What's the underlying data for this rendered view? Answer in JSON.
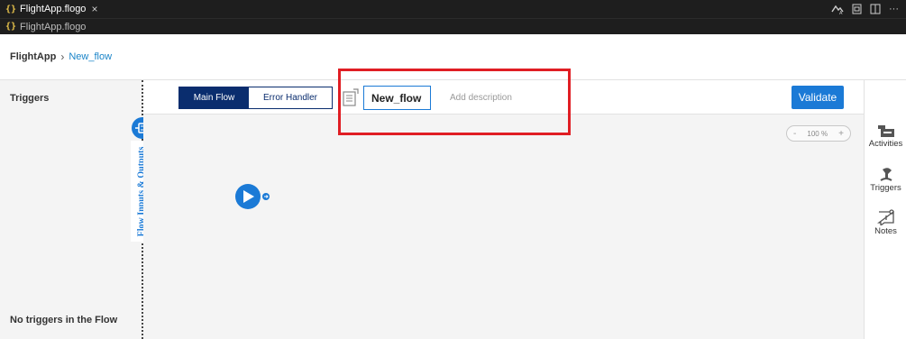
{
  "editor": {
    "tab_label": "FlightApp.flogo",
    "tab_close": "×",
    "path_label": "FlightApp.flogo",
    "json_glyph": "{}",
    "actions": [
      "split-editor-icon",
      "open-preview-icon",
      "layout-icon",
      "more-actions-icon"
    ],
    "more_glyph": "···"
  },
  "breadcrumb": {
    "app": "FlightApp",
    "separator": "›",
    "flow": "New_flow"
  },
  "triggers": {
    "title": "Triggers",
    "empty_text": "No triggers in the Flow",
    "io_label": "Flow Inputs & Outputs"
  },
  "toolbar": {
    "tabs": [
      {
        "label": "Main Flow",
        "active": true
      },
      {
        "label": "Error Handler",
        "active": false
      }
    ],
    "flow_name": "New_flow",
    "description_placeholder": "Add description",
    "validate_label": "Validate"
  },
  "zoom": {
    "minus": "-",
    "level": "100 %",
    "plus": "+"
  },
  "palette": {
    "items": [
      {
        "label": "Activities",
        "icon": "activities-icon"
      },
      {
        "label": "Triggers",
        "icon": "triggers-icon"
      },
      {
        "label": "Notes",
        "icon": "notes-icon"
      }
    ]
  },
  "colors": {
    "accent": "#1b7ad6",
    "nav_dark": "#0a2d6e",
    "highlight": "#e01e24"
  }
}
